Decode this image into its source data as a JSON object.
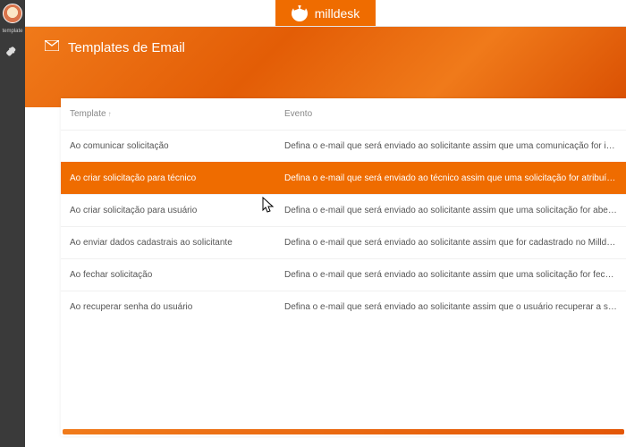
{
  "sidebar": {
    "label": "template"
  },
  "brand": {
    "name": "milldesk"
  },
  "page": {
    "title": "Templates de Email"
  },
  "table": {
    "headers": {
      "template": "Template",
      "evento": "Evento"
    },
    "sort_indicator": "↑",
    "rows": [
      {
        "template": "Ao comunicar solicitação",
        "evento": "Defina o e-mail que será enviado ao solicitante assim que uma comunicação for inserida no Milldesk pelo",
        "selected": false
      },
      {
        "template": "Ao criar solicitação para técnico",
        "evento": "Defina o e-mail que será enviado ao técnico assim que uma solicitação for atribuída em seu nome.",
        "selected": true
      },
      {
        "template": "Ao criar solicitação para usuário",
        "evento": "Defina o e-mail que será enviado ao solicitante assim que uma solicitação for aberta em seu nome.",
        "selected": false
      },
      {
        "template": "Ao enviar dados cadastrais ao solicitante",
        "evento": "Defina o e-mail que será enviado ao solicitante assim que for cadastrado no Milldesk ou houver uma troca",
        "selected": false
      },
      {
        "template": "Ao fechar solicitação",
        "evento": "Defina o e-mail que será enviado ao solicitante assim que uma solicitação for fechada.",
        "selected": false
      },
      {
        "template": "Ao recuperar senha do usuário",
        "evento": "Defina o e-mail que será enviado ao solicitante assim que o usuário recuperar a sua senha de acesso ao M",
        "selected": false
      }
    ]
  },
  "colors": {
    "brand_orange": "#ef6c00",
    "sidebar_bg": "#3a3a3a"
  }
}
